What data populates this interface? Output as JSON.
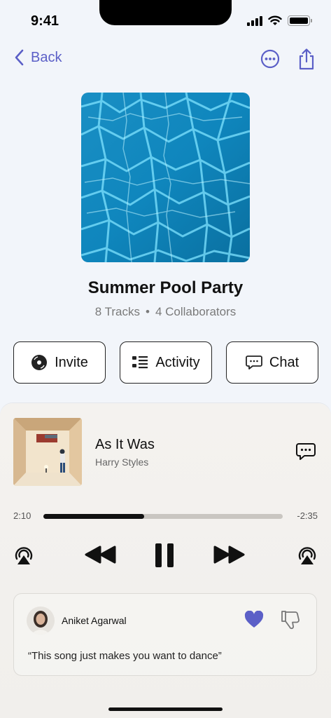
{
  "status_bar": {
    "time": "9:41"
  },
  "nav": {
    "back_label": "Back"
  },
  "playlist": {
    "title": "Summer Pool Party",
    "tracks": "8 Tracks",
    "separator": "•",
    "collaborators": "4 Collaborators"
  },
  "actions": [
    {
      "label": "Invite",
      "icon": "vinyl-disc-icon"
    },
    {
      "label": "Activity",
      "icon": "list-icon"
    },
    {
      "label": "Chat",
      "icon": "chat-bubble-icon"
    }
  ],
  "now_playing": {
    "title": "As It Was",
    "artist": "Harry Styles",
    "elapsed": "2:10",
    "remaining": "-2:35",
    "progress": 0.42
  },
  "comment": {
    "user": "Aniket Agarwal",
    "text": "“This song just makes you want to dance”",
    "liked": true
  },
  "colors": {
    "accent": "#5b5fc7",
    "heart": "#5b5fc7",
    "background": "#f2f5fa",
    "player_background": "#f3f1ee"
  }
}
